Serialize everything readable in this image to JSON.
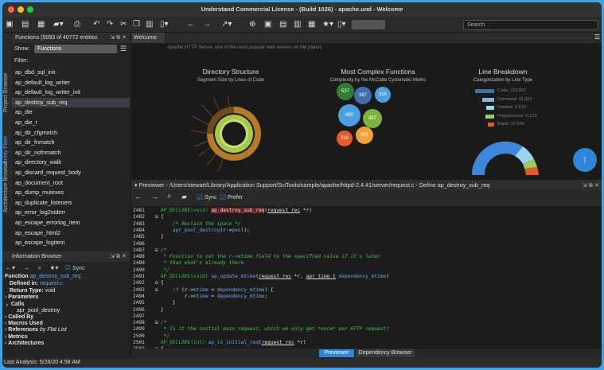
{
  "window": {
    "title": "Understand Commercial License - (Build 1026) - apache.und - Welcome"
  },
  "toolbar": {
    "search_placeholder": "Search"
  },
  "functions_panel": {
    "title": "Functions (5093 of 40772 entities",
    "show_label": "Show:",
    "show_value": "Functions",
    "filter_label": "Filter:",
    "items": [
      "ap_dbd_sql_init",
      "ap_default_log_writer",
      "ap_default_log_writer_init",
      "ap_destroy_sub_req",
      "ap_die",
      "ap_die_r",
      "ap_dir_cfgmatch",
      "ap_dir_fnmatch",
      "ap_dir_nofnmatch",
      "ap_directory_walk",
      "ap_discard_request_body",
      "ap_document_root",
      "ap_dump_mutexes",
      "ap_duplicate_listeners",
      "ap_error_log2stderr",
      "ap_escape_errorlog_item",
      "ap_escape_html2",
      "ap_escape_logitem"
    ],
    "selected_index": 3
  },
  "vertical_tabs": [
    "Project Browser",
    "Entity Filter",
    "Architecture Browser"
  ],
  "info_panel": {
    "title": "Information Browser",
    "sync_label": "Sync",
    "function_label": "Function",
    "function_name": "ap_destroy_sub_req",
    "defined_label": "Defined in:",
    "defined_value": "request.c",
    "return_label": "Return Type:",
    "return_value": "void",
    "parameters": "Parameters",
    "calls": "Calls",
    "calls_item": "apr_pool_destroy",
    "called_by": "Called By",
    "macros_used": "Macros Used",
    "references": "References",
    "references_suffix": "by Flat List",
    "metrics": "Metrics",
    "architectures": "Architectures"
  },
  "welcome": {
    "tab_label": "Welcome",
    "intro": "Apache HTTP Server, one of the most popular web servers on the planet.",
    "directory": {
      "title": "Directory Structure",
      "subtitle": "Segment Size by Lines of Code"
    },
    "complex": {
      "title": "Most Complex Functions",
      "subtitle": "Complexity by the McCabe Cyclomatic Metric",
      "bubbles": [
        "537",
        "367",
        "316",
        "690",
        "497",
        "318",
        "393"
      ],
      "colors": [
        "#2e7d32",
        "#3f6fae",
        "#4aa0e0",
        "#4aa0e0",
        "#7cb342",
        "#e65a2a",
        "#f2a23a"
      ]
    },
    "lines": {
      "title": "Line Breakdown",
      "subtitle": "Categorization by Line Type",
      "legend": [
        {
          "label": "Code: 118,992",
          "color": "#3f6fae",
          "frac": 1.0
        },
        {
          "label": "Comment: 31,921",
          "color": "#7fb3e8",
          "frac": 0.62
        },
        {
          "label": "Inactive: 3,613",
          "color": "#9fd4f0",
          "frac": 0.4
        },
        {
          "label": "Preprocessor: 6,219",
          "color": "#9ccc65",
          "frac": 0.45
        },
        {
          "label": "Blank: 22,545",
          "color": "#e65a2a",
          "frac": 0.35
        }
      ]
    }
  },
  "previewer": {
    "title": "Previewer - /Users/stewart/Library/Application Support/SciTools/sample/apache/httpd-2.4.41/server/request.c - Define ap_destroy_sub_req",
    "sync_label": "Sync",
    "prefer_label": "Prefer"
  },
  "code_lines": [
    {
      "n": "2481",
      "h": "<span class='kw'>AP_DECLARE(void)</span> <span class='hl'>ap_destroy_sub_req</span>(<span class='ul'>request_rec</span> *r)"
    },
    {
      "n": "2482",
      "m": "⊟",
      "h": "{"
    },
    {
      "n": "2483",
      "h": "    <span class='cm'>/* Reclaim the space */</span>"
    },
    {
      "n": "2484",
      "h": "    <span class='vr'>apr_pool_destroy</span>(r-><span class='vr'>pool</span>);"
    },
    {
      "n": "2485",
      "h": "}"
    },
    {
      "n": "2486",
      "h": ""
    },
    {
      "n": "2487",
      "m": "⊟",
      "h": "<span class='cm'>/*</span>"
    },
    {
      "n": "2488",
      "h": "<span class='cm'> * Function to set the r->mtime field to the specified value if it's later</span>"
    },
    {
      "n": "2489",
      "h": "<span class='cm'> * than what's already there.</span>"
    },
    {
      "n": "2490",
      "h": "<span class='cm'> */</span>"
    },
    {
      "n": "2491",
      "h": "<span class='kw'>AP_DECLARE(void)</span> <span class='vr'>ap_update_mtime</span>(<span class='ul'>request_rec</span> *r, <span class='ul'>apr_time_t</span> <span class='vr'>dependency_mtime</span>)"
    },
    {
      "n": "2492",
      "m": "⊟",
      "h": "{"
    },
    {
      "n": "2493",
      "m": "⊟",
      "h": "    <span class='kw'>if</span> (r-><span class='vr'>mtime</span> < <span class='vr'>dependency_mtime</span>) {"
    },
    {
      "n": "2494",
      "h": "        r-><span class='vr'>mtime</span> = <span class='vr'>dependency_mtime</span>;"
    },
    {
      "n": "2495",
      "h": "    }"
    },
    {
      "n": "2496",
      "h": "}"
    },
    {
      "n": "2497",
      "h": ""
    },
    {
      "n": "2498",
      "m": "⊟",
      "h": "<span class='cm'>/*</span>"
    },
    {
      "n": "2499",
      "h": "<span class='cm'> * Is it the initial main request, which we only get *once* per HTTP request?</span>"
    },
    {
      "n": "2500",
      "h": "<span class='cm'> */</span>"
    },
    {
      "n": "2501",
      "h": "<span class='kw'>AP_DECLARE(int)</span> <span class='vr'>ap_is_initial_req</span>(<span class='ul'>request_rec</span> *r)"
    },
    {
      "n": "2502",
      "m": "⊟",
      "h": "{"
    }
  ],
  "bottom_tabs": [
    "Previewer",
    "Dependency Browser"
  ],
  "status": {
    "text": "Last Analysis: 5/28/20 4:58 AM"
  }
}
